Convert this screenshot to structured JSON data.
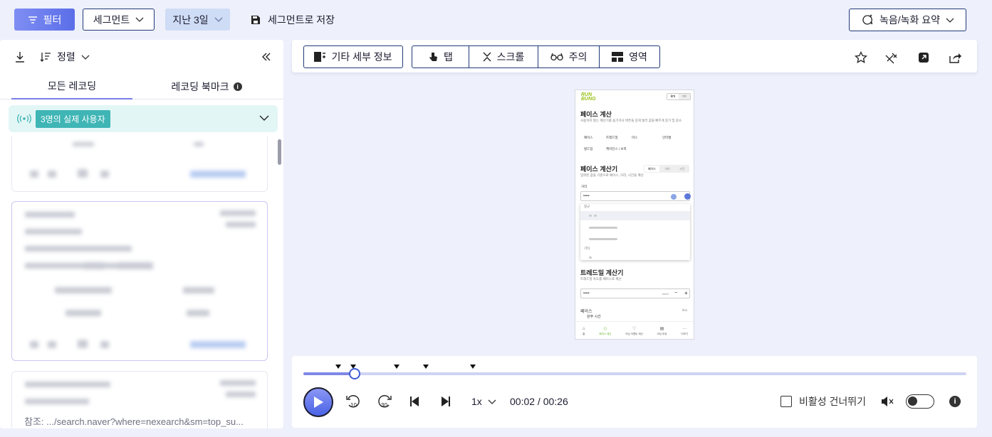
{
  "topbar": {
    "filter_label": "필터",
    "segment_label": "세그먼트",
    "days_label": "지난 3일",
    "save_segment_label": "세그먼트로 저장",
    "summary_label": "녹음/녹화 요약"
  },
  "left": {
    "sort_label": "정렬",
    "tabs": [
      "모든 레코딩",
      "레코딩 북마크"
    ],
    "users_badge": "3명의 실제 사용자",
    "ref_line": "참조: .../search.naver?where=nexearch&sm=top_su..."
  },
  "toolbar": {
    "details_label": "기타 세부 정보",
    "tap_label": "탭",
    "scroll_label": "스크롤",
    "attention_label": "주의",
    "area_label": "영역"
  },
  "phone": {
    "logo_line1": "RUN",
    "logo_line2": "BUNG",
    "unit_km": "km",
    "unit_mi": "mi",
    "pace_calc_title": "페이스 계산",
    "pace_calc_desc": "사용하지 않는 계산기를 숨기거나 버튼을 길게 눌러 값을 빠르게 증가 및 감소",
    "chips": [
      "페이스",
      "트레드밀",
      "마스",
      "인터벌",
      "빌드업",
      "케이던스 / 보폭"
    ],
    "pace_calculator_title": "페이스 계산기",
    "pace_calculator_desc": "입력된 값을 기준으로 페이스, 거리, 시간을 계산",
    "seg_tabs": [
      "페이스",
      "거리",
      "시간"
    ],
    "distance_label": "거리",
    "masked_value": "•••••",
    "drop_sections": [
      "정규",
      "기타"
    ],
    "treadmill_title": "트레드밀 계산기",
    "treadmill_desc": "트레드밀 속도를 페이스로 계산",
    "treadmill_unit": "km/h",
    "pace_label": "페이스",
    "pace_unit": "/km",
    "finish_time": "완주 시간",
    "nav": [
      "홈",
      "페이스 계산",
      "러닝 이벤트 계산",
      "러닝 부상",
      "더보기"
    ]
  },
  "player": {
    "speed": "1x",
    "time": "00:02 / 00:26",
    "skip_inactive_label": "비활성 건너뛰기",
    "rewind_seconds": "10",
    "forward_seconds": "30",
    "progress_fraction": 0.077
  },
  "colors": {
    "accent": "#5b6ee8",
    "badge_teal": "#3fb5b5",
    "outline_navy": "#1f3a78",
    "brand_green": "#9bc21a"
  }
}
